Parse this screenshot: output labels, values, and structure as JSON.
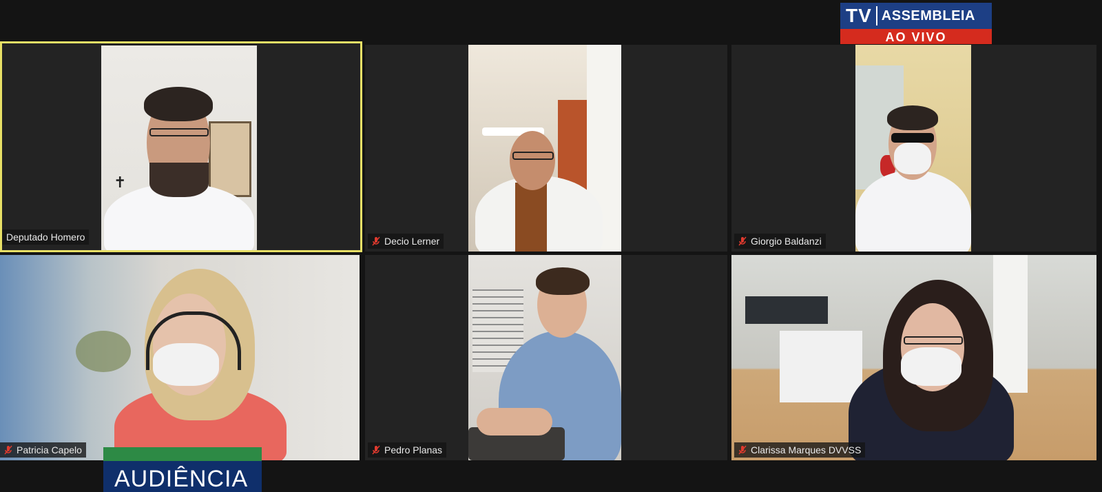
{
  "broadcast": {
    "logo_tv": "TV",
    "logo_name": "ASSEMBLEIA",
    "logo_live": "AO VIVO",
    "program_label": "AUDIÊNCIA"
  },
  "participants": [
    {
      "name": "Deputado Homero",
      "muted": false,
      "active_speaker": true
    },
    {
      "name": "Decio Lerner",
      "muted": true
    },
    {
      "name": "Giorgio Baldanzi",
      "muted": true
    },
    {
      "name": "Patricia Capelo",
      "muted": true
    },
    {
      "name": "Pedro Planas",
      "muted": true
    },
    {
      "name": "Clarissa Marques DVVSS",
      "muted": true
    }
  ],
  "colors": {
    "active_border": "#e8e066",
    "logo_blue": "#1d3f85",
    "logo_red": "#d52b1e",
    "program_blue": "#0f2f6b",
    "program_green": "#2d8a45"
  }
}
